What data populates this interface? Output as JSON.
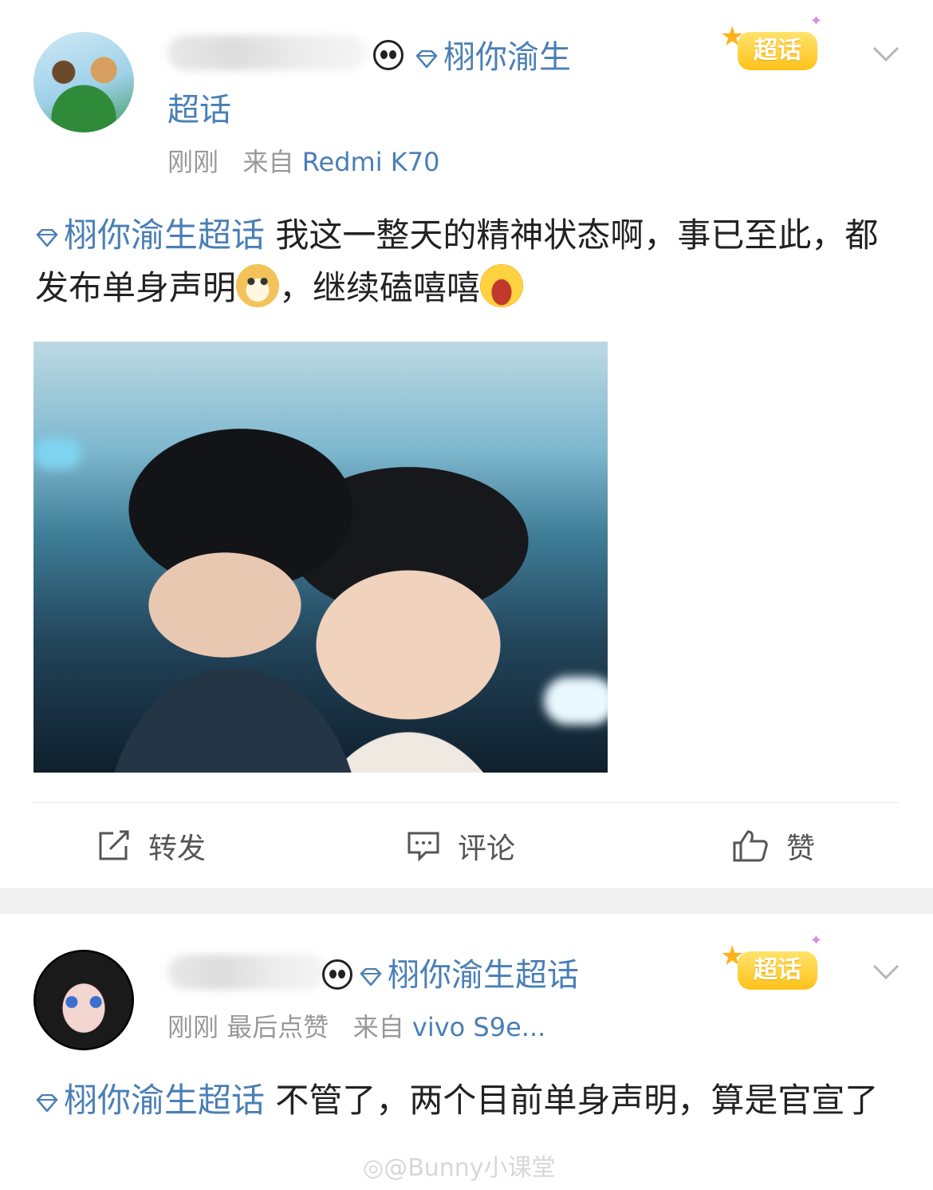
{
  "post1": {
    "topic_title_line1": "栩你渝生",
    "topic_title_line2": "超话",
    "time": "刚刚",
    "source_prefix": "来自",
    "source_device": "Redmi K70",
    "badge_label": "超话",
    "content_topic": "栩你渝生超话",
    "content_part1": " 我这一整天的精神状态啊，事已至此，都发布单身声明",
    "content_part2": "，继续磕嘻嘻",
    "actions": {
      "repost": "转发",
      "comment": "评论",
      "like": "赞"
    }
  },
  "post2": {
    "topic_title": "栩你渝生超话",
    "time": "刚刚",
    "last_like": "最后点赞",
    "source_prefix": "来自",
    "source_device": "vivo S9e...",
    "badge_label": "超话",
    "content_topic": "栩你渝生超话",
    "content_text": " 不管了，两个目前单身声明，算是官宣了"
  },
  "watermark": "@Bunny小课堂",
  "colors": {
    "link_blue": "#4a7fb5",
    "badge_yellow": "#ffc21a",
    "meta_gray": "#999999"
  }
}
